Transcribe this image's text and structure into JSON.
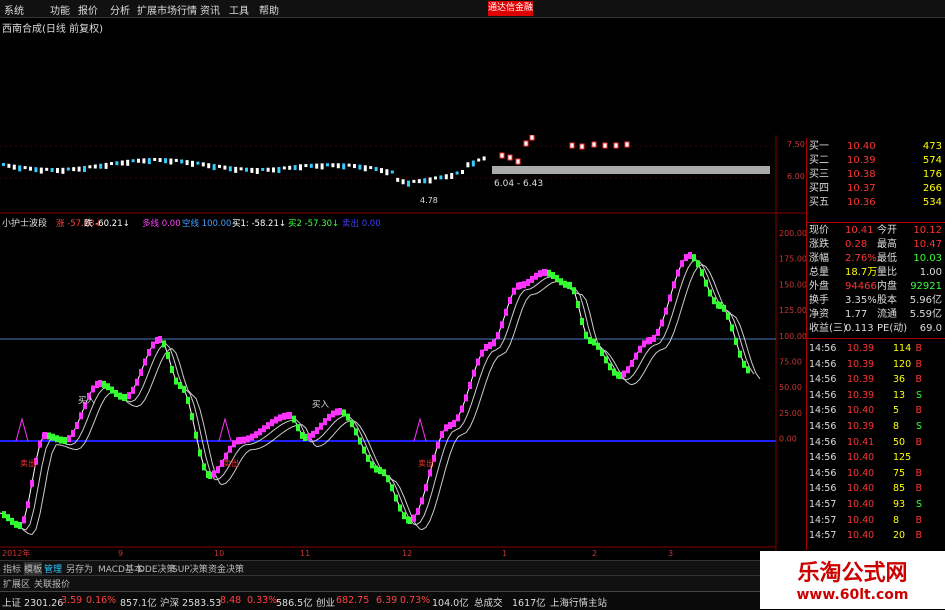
{
  "menu": [
    "系统",
    "功能",
    "报价",
    "分析",
    "扩展市场行情",
    "资讯",
    "工具",
    "帮助"
  ],
  "badge": "通达信金融",
  "chart_title": "西南合成(日线 前复权)",
  "price_axis": [
    "7.50",
    "6.00"
  ],
  "price_annotations": {
    "range_label": "6.04 - 6.43",
    "low_label": "4.78"
  },
  "indicator": {
    "name": "小护士波段",
    "items": [
      {
        "label": "涨 -57.63↓",
        "color": "#ff4040"
      },
      {
        "label": "跌 -60.21↓",
        "color": "#ffffff"
      },
      {
        "label": "多线 0.00",
        "color": "#ff40ff"
      },
      {
        "label": "空线 100.00",
        "color": "#40a0ff"
      },
      {
        "label": "买1: -58.21↓",
        "color": "#ffffff"
      },
      {
        "label": "买2 -57.30↓",
        "color": "#40ff40"
      },
      {
        "label": "卖出 0.00",
        "color": "#4040ff"
      }
    ],
    "axis": [
      "200.00",
      "175.00",
      "150.00",
      "125.00",
      "100.00",
      "75.00",
      "50.00",
      "25.00",
      "0.00"
    ],
    "signals": {
      "buy": "买入",
      "sell": "卖出"
    }
  },
  "time_axis": [
    "2012年",
    "9",
    "10",
    "11",
    "12",
    "1",
    "2",
    "3"
  ],
  "quote": {
    "bids": [
      {
        "label": "买一",
        "price": "10.40",
        "vol": "473"
      },
      {
        "label": "买二",
        "price": "10.39",
        "vol": "574"
      },
      {
        "label": "买三",
        "price": "10.38",
        "vol": "176"
      },
      {
        "label": "买四",
        "price": "10.37",
        "vol": "266"
      },
      {
        "label": "买五",
        "price": "10.36",
        "vol": "534"
      }
    ],
    "stats": [
      {
        "l1": "现价",
        "v1": "10.41",
        "l2": "今开",
        "v2": "10.12"
      },
      {
        "l1": "涨跌",
        "v1": "0.28",
        "l2": "最高",
        "v2": "10.47"
      },
      {
        "l1": "涨幅",
        "v1": "2.76%",
        "l2": "最低",
        "v2": "10.03"
      },
      {
        "l1": "总量",
        "v1": "18.7万",
        "l2": "量比",
        "v2": "1.00"
      },
      {
        "l1": "外盘",
        "v1": "94466",
        "l2": "内盘",
        "v2": "92921"
      },
      {
        "l1": "换手",
        "v1": "3.35%",
        "l2": "股本",
        "v2": "5.96亿"
      },
      {
        "l1": "净资",
        "v1": "1.77",
        "l2": "流通",
        "v2": "5.59亿"
      },
      {
        "l1": "收益(三)",
        "v1": "0.113",
        "l2": "PE(动)",
        "v2": "69.0"
      }
    ]
  },
  "ticks": [
    {
      "time": "14:56",
      "price": "10.39",
      "vol": "114",
      "side": "B"
    },
    {
      "time": "14:56",
      "price": "10.39",
      "vol": "120",
      "side": "B"
    },
    {
      "time": "14:56",
      "price": "10.39",
      "vol": "36",
      "side": "B"
    },
    {
      "time": "14:56",
      "price": "10.39",
      "vol": "13",
      "side": "S"
    },
    {
      "time": "14:56",
      "price": "10.40",
      "vol": "5",
      "side": "B"
    },
    {
      "time": "14:56",
      "price": "10.39",
      "vol": "8",
      "side": "S"
    },
    {
      "time": "14:56",
      "price": "10.41",
      "vol": "50",
      "side": "B"
    },
    {
      "time": "14:56",
      "price": "10.40",
      "vol": "125",
      "side": ""
    },
    {
      "time": "14:56",
      "price": "10.40",
      "vol": "75",
      "side": "B"
    },
    {
      "time": "14:56",
      "price": "10.40",
      "vol": "85",
      "side": "B"
    },
    {
      "time": "14:57",
      "price": "10.40",
      "vol": "93",
      "side": "S"
    },
    {
      "time": "14:57",
      "price": "10.40",
      "vol": "8",
      "side": "B"
    },
    {
      "time": "14:57",
      "price": "10.40",
      "vol": "20",
      "side": "B"
    }
  ],
  "tabs": [
    "指标",
    "模板",
    "管理",
    "另存为",
    "MACD基本",
    "DDE决策",
    "SUP决策",
    "资金决策"
  ],
  "tabs2": [
    "扩展区",
    "关联报价"
  ],
  "status": [
    {
      "text": "上证 2301.26",
      "color": "#ddd"
    },
    {
      "text": "3.59",
      "color": "#ff4040"
    },
    {
      "text": "0.16%",
      "color": "#ff4040"
    },
    {
      "text": "857.1亿",
      "color": "#ddd"
    },
    {
      "text": "沪深 2583.53",
      "color": "#ddd"
    },
    {
      "text": "8.48",
      "color": "#ff4040"
    },
    {
      "text": "0.33%",
      "color": "#ff4040"
    },
    {
      "text": "586.5亿",
      "color": "#ddd"
    },
    {
      "text": "创业",
      "color": "#ddd"
    },
    {
      "text": "682.75",
      "color": "#ff4040"
    },
    {
      "text": "6.39",
      "color": "#ff4040"
    },
    {
      "text": "0.73%",
      "color": "#ff4040"
    },
    {
      "text": "104.0亿",
      "color": "#ddd"
    },
    {
      "text": "总成交",
      "color": "#ddd"
    },
    {
      "text": "1617亿",
      "color": "#ddd"
    },
    {
      "text": "上海行情主站",
      "color": "#ddd"
    }
  ],
  "watermark": {
    "title": "乐淘公式网",
    "url": "www.60lt.com"
  }
}
